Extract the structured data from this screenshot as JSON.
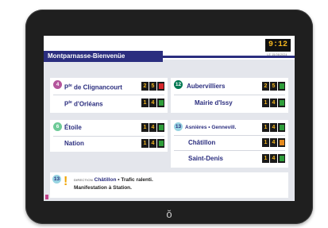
{
  "header": {
    "station": "Montparnasse-Bienvenüe",
    "clock": "9:12",
    "clock_sub": "LE 15/06/2024"
  },
  "panels": [
    {
      "line": "4",
      "rows": [
        {
          "dest_sup": "P",
          "dest_sup2": "te",
          "dest": "de Clignancourt",
          "digits": [
            "2",
            "5"
          ],
          "status": "red"
        },
        {
          "dest_sup": "P",
          "dest_sup2": "te",
          "dest": "d'Orléans",
          "digits": [
            "1",
            "4"
          ],
          "status": "green"
        }
      ]
    },
    {
      "line": "12",
      "rows": [
        {
          "dest": "Aubervilliers",
          "digits": [
            "2",
            "5"
          ],
          "status": "green"
        },
        {
          "dest": "Mairie d'Issy",
          "digits": [
            "1",
            "4"
          ],
          "status": "green"
        }
      ]
    },
    {
      "line": "6",
      "rows": [
        {
          "dest": "Étoile",
          "digits": [
            "1",
            "4"
          ],
          "status": "green"
        },
        {
          "dest": "Nation",
          "digits": [
            "1",
            "4"
          ],
          "status": "green"
        }
      ]
    },
    {
      "line": "13",
      "rows": [
        {
          "dest": "Asnières • Gennevill.",
          "digits": [
            "1",
            "4"
          ],
          "status": "green"
        },
        {
          "dest": "Châtillon",
          "digits": [
            "1",
            "4"
          ],
          "status": "orange"
        },
        {
          "dest": "Saint-Denis",
          "digits": [
            "1",
            "4"
          ],
          "status": "green"
        }
      ]
    }
  ],
  "info": {
    "line": "13",
    "direction_label": "DIRECTION",
    "direction": "Châtillon",
    "message1": "• Trafic ralenti.",
    "message2": "Manifestation à Station."
  },
  "colors": {
    "navy": "#2b2e7f",
    "line4": "#b4559c",
    "line12": "#007852",
    "line6": "#6eca97",
    "line13": "#98d4e2",
    "green": "#2f9e3a",
    "red": "#d8262b",
    "orange": "#e58a1e"
  },
  "icons": {
    "home": "home-button-icon",
    "warning": "warning-icon"
  }
}
